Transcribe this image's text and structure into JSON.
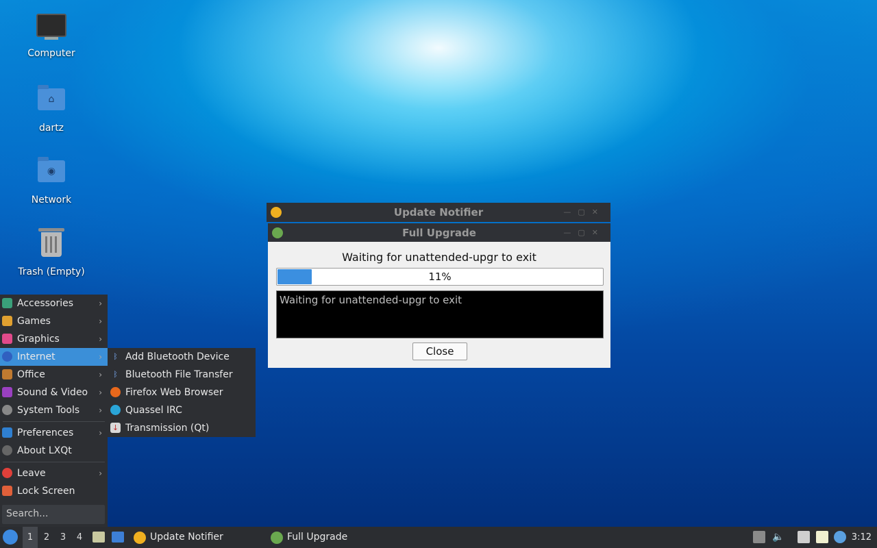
{
  "desktop": {
    "icons": [
      {
        "label": "Computer"
      },
      {
        "label": "dartz"
      },
      {
        "label": "Network"
      },
      {
        "label": "Trash (Empty)"
      }
    ]
  },
  "menu": {
    "categories": [
      {
        "label": "Accessories",
        "icon": "accessories-icon",
        "color": "#3aa07a"
      },
      {
        "label": "Games",
        "icon": "games-icon",
        "color": "#e0a030"
      },
      {
        "label": "Graphics",
        "icon": "graphics-icon",
        "color": "#e04a8a"
      },
      {
        "label": "Internet",
        "icon": "internet-icon",
        "color": "#3060c0"
      },
      {
        "label": "Office",
        "icon": "office-icon",
        "color": "#c07a30"
      },
      {
        "label": "Sound & Video",
        "icon": "sound-video-icon",
        "color": "#9a40c0"
      },
      {
        "label": "System Tools",
        "icon": "system-tools-icon",
        "color": "#888888"
      }
    ],
    "preferences": "Preferences",
    "about": "About LXQt",
    "leave": "Leave",
    "lock_screen": "Lock Screen",
    "search_placeholder": "Search...",
    "active_item": "Internet",
    "accent_color": "#3b8fd8"
  },
  "submenu": {
    "items": [
      {
        "label": "Add Bluetooth Device",
        "icon": "bluetooth-icon"
      },
      {
        "label": "Bluetooth File Transfer",
        "icon": "bluetooth-icon"
      },
      {
        "label": "Firefox Web Browser",
        "icon": "firefox-icon"
      },
      {
        "label": "Quassel IRC",
        "icon": "quassel-icon"
      },
      {
        "label": "Transmission (Qt)",
        "icon": "transmission-icon"
      }
    ]
  },
  "windows": {
    "update_notifier": {
      "title": "Update Notifier"
    },
    "full_upgrade": {
      "title": "Full Upgrade",
      "message": "Waiting for unattended-upgr to exit",
      "progress_percent": 11,
      "progress_label": "11%",
      "terminal_text": "Waiting for unattended-upgr to exit",
      "close_label": "Close"
    }
  },
  "taskbar": {
    "workspaces": [
      "1",
      "2",
      "3",
      "4"
    ],
    "active_workspace": "1",
    "tasks": [
      {
        "label": "Update Notifier",
        "icon": "update-notifier-icon"
      },
      {
        "label": "Full Upgrade",
        "icon": "gear-icon"
      }
    ],
    "clock": "3:12"
  }
}
